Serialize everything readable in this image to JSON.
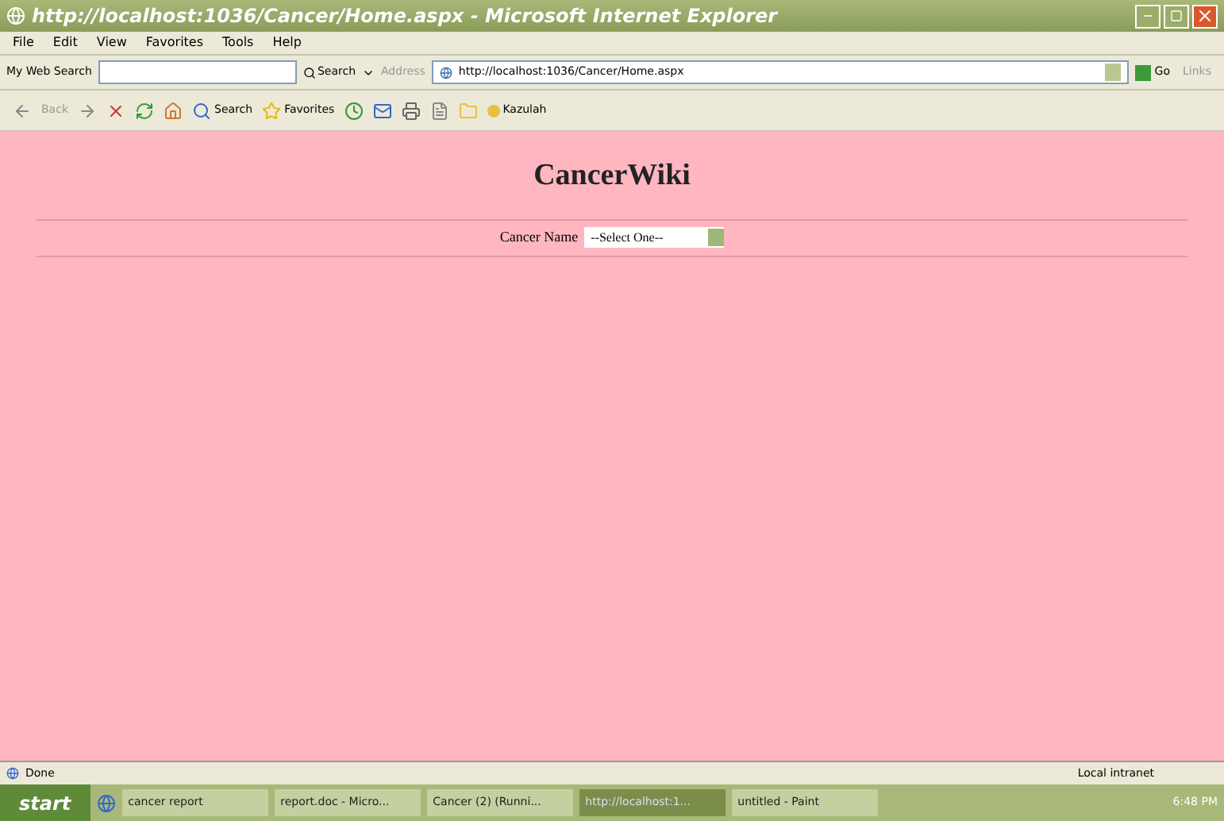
{
  "window": {
    "title": "http://localhost:1036/Cancer/Home.aspx - Microsoft Internet Explorer"
  },
  "menu": [
    "File",
    "Edit",
    "View",
    "Favorites",
    "Tools",
    "Help"
  ],
  "search_bar": {
    "label": "My Web Search",
    "button": "Search",
    "address_label": "Address",
    "address": "http://localhost:1036/Cancer/Home.aspx",
    "go": "Go",
    "links": "Links"
  },
  "toolbar": {
    "back": "Back",
    "search": "Search",
    "favorites": "Favorites",
    "user": "Kazulah"
  },
  "page": {
    "heading": "CancerWiki",
    "field_label": "Cancer Name",
    "select_value": "--Select One--"
  },
  "status_bar": {
    "text": "Done",
    "zone": "Local intranet"
  },
  "taskbar": {
    "start": "start",
    "tasks": [
      {
        "label": "cancer report",
        "selected": false
      },
      {
        "label": "report.doc - Micro...",
        "selected": false
      },
      {
        "label": "Cancer (2) (Runni...",
        "selected": false
      },
      {
        "label": "http://localhost:1...",
        "selected": true
      },
      {
        "label": "untitled - Paint",
        "selected": false
      }
    ],
    "clock": "6:48 PM"
  }
}
